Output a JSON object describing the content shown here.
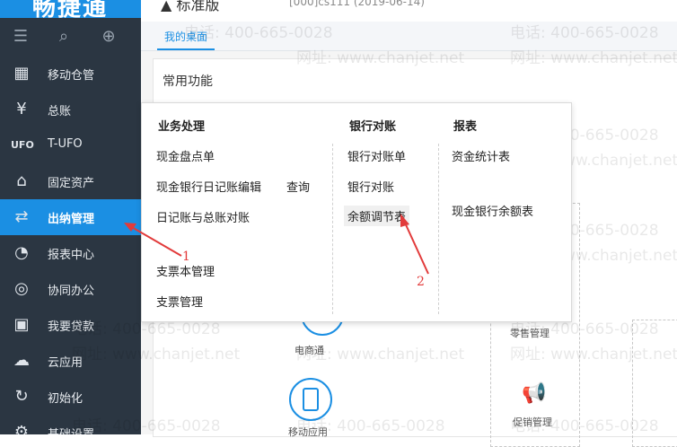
{
  "app": {
    "logo_text": "畅捷通",
    "edition": "标准版",
    "account": "[000]cs111  (2019-06-14)"
  },
  "tabs": [
    {
      "label": "我的桌面"
    }
  ],
  "sidebar": {
    "items": [
      {
        "label": "移动仓管",
        "icon": "warehouse-icon"
      },
      {
        "label": "总账",
        "icon": "ledger-icon"
      },
      {
        "label": "T-UFO",
        "icon": "ufo-report-icon"
      },
      {
        "label": "固定资产",
        "icon": "bank-building-icon"
      },
      {
        "label": "出纳管理",
        "icon": "cashier-icon",
        "active": true
      },
      {
        "label": "报表中心",
        "icon": "pie-chart-icon"
      },
      {
        "label": "协同办公",
        "icon": "collaboration-icon"
      },
      {
        "label": "我要贷款",
        "icon": "loan-icon"
      },
      {
        "label": "云应用",
        "icon": "cloud-icon"
      },
      {
        "label": "初始化",
        "icon": "init-icon"
      },
      {
        "label": "基础设置",
        "icon": "settings-gear-icon"
      }
    ]
  },
  "main": {
    "common_title": "常用功能",
    "tiles": [
      {
        "label": "电商通"
      },
      {
        "label": "移动应用"
      },
      {
        "label": "零售管理"
      },
      {
        "label": "促销管理"
      }
    ]
  },
  "popup": {
    "columns": [
      {
        "header": "业务处理",
        "items": [
          "现金盘点单",
          "现金银行日记账编辑",
          "日记账与总账对账",
          "支票本管理",
          "支票管理"
        ],
        "extra": "查询"
      },
      {
        "header": "银行对账",
        "items": [
          "银行对账单",
          "银行对账",
          "余额调节表"
        ]
      },
      {
        "header": "报表",
        "items": [
          "资金统计表",
          "现金银行余额表"
        ]
      }
    ]
  },
  "watermark": {
    "phone": "电话: 400-665-0028",
    "site": "网址: www.chanjet.net"
  },
  "annotations": {
    "one": "1",
    "two": "2"
  },
  "colors": {
    "accent": "#1b8fe3",
    "sidebar_bg": "#2b3642",
    "annotation": "#e23b3b"
  }
}
